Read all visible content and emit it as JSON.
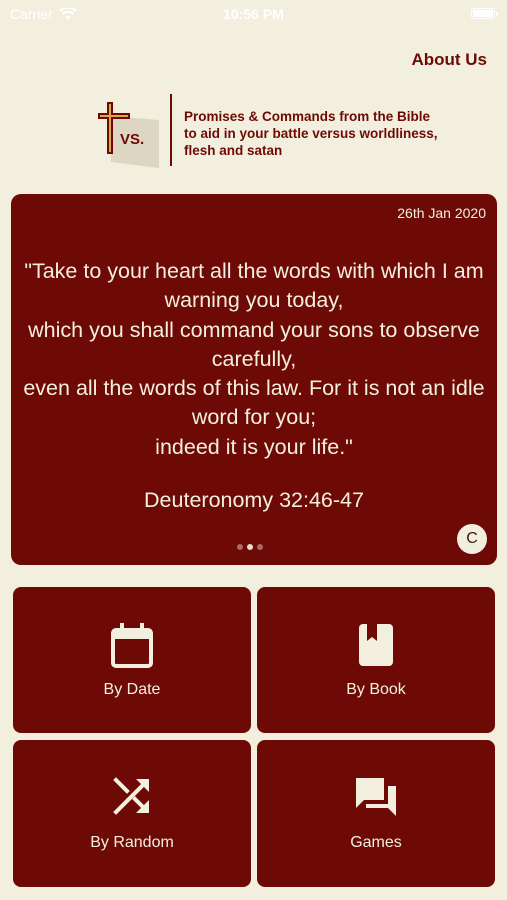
{
  "status_bar": {
    "carrier": "Carrier",
    "time": "10:56 PM"
  },
  "header": {
    "about_label": "About Us",
    "logo_text": "VS.",
    "tagline": "Promises & Commands from the Bible to aid in your battle versus worldliness, flesh and satan"
  },
  "verse_card": {
    "date": "26th Jan 2020",
    "text": "\"Take to your heart all the words with which I am warning you today,\nwhich you shall command your sons to observe carefully,\neven all the words of this law. For it is not an idle word for you;\nindeed it is your life.\"",
    "reference": "Deuteronomy 32:46-47",
    "copyright_badge": "C",
    "pager": {
      "count": 3,
      "active_index": 1
    }
  },
  "menu": {
    "by_date": {
      "label": "By Date",
      "icon": "calendar-icon"
    },
    "by_book": {
      "label": "By Book",
      "icon": "book-icon"
    },
    "by_random": {
      "label": "By Random",
      "icon": "shuffle-icon"
    },
    "games": {
      "label": "Games",
      "icon": "chat-bubbles-icon"
    }
  },
  "colors": {
    "brand": "#6e0a06",
    "background": "#f3efdf",
    "accent_gold": "#d8a84a"
  }
}
